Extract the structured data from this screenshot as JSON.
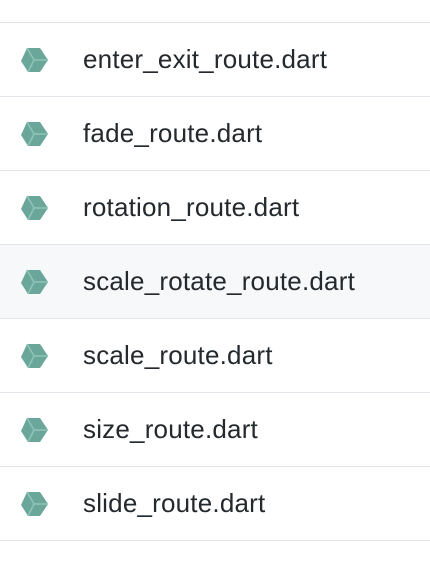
{
  "files": [
    {
      "name": "enter_exit_route.dart",
      "icon": "dart-file-icon",
      "icon_color": "#6aa79a"
    },
    {
      "name": "fade_route.dart",
      "icon": "dart-file-icon",
      "icon_color": "#6aa79a"
    },
    {
      "name": "rotation_route.dart",
      "icon": "dart-file-icon",
      "icon_color": "#6aa79a"
    },
    {
      "name": "scale_rotate_route.dart",
      "icon": "dart-file-icon",
      "icon_color": "#6aa79a",
      "hover": true
    },
    {
      "name": "scale_route.dart",
      "icon": "dart-file-icon",
      "icon_color": "#6aa79a"
    },
    {
      "name": "size_route.dart",
      "icon": "dart-file-icon",
      "icon_color": "#6aa79a"
    },
    {
      "name": "slide_route.dart",
      "icon": "dart-file-icon",
      "icon_color": "#6aa79a"
    }
  ],
  "colors": {
    "text": "#24292e",
    "divider": "#e1e4e8",
    "hover_background": "#f6f8fa",
    "icon": "#6aa79a"
  }
}
